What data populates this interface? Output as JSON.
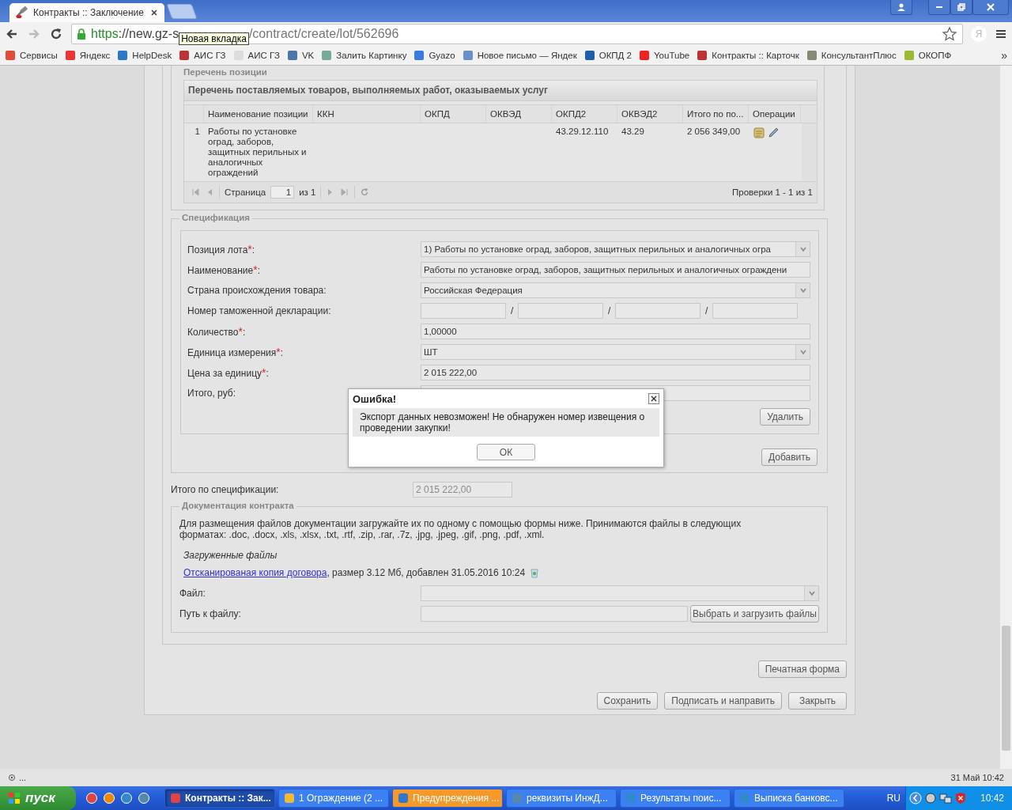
{
  "browser": {
    "tabs": [
      {
        "title": "Контракты :: Заключение",
        "selected": true
      }
    ],
    "url": {
      "scheme": "https",
      "host_part": "://new.gz-s",
      "path_part": "/contract/create/lot/562696"
    },
    "tooltip": "Новая вкладка",
    "profile_letter": "Я",
    "bookmarks": [
      {
        "label": "Сервисы"
      },
      {
        "label": "Яндекс"
      },
      {
        "label": "HelpDesk"
      },
      {
        "label": "АИС ГЗ"
      },
      {
        "label": "АИС ГЗ"
      },
      {
        "label": "VK"
      },
      {
        "label": "Залить Картинку"
      },
      {
        "label": "Gyazo"
      },
      {
        "label": "Новое письмо — Яндек"
      },
      {
        "label": "ОКПД 2"
      },
      {
        "label": "YouTube"
      },
      {
        "label": "Контракты :: Карточк"
      },
      {
        "label": "КонсультантПлюс"
      },
      {
        "label": "ОКОПФ"
      }
    ],
    "bookmarks_more": "»"
  },
  "positions": {
    "legend": "Перечень позиции",
    "grid_title": "Перечень поставляемых товаров, выполняемых работ, оказываемых услуг",
    "columns": [
      "Наименование позиции",
      "ККН",
      "ОКПД",
      "ОКВЭД",
      "ОКПД2",
      "ОКВЭД2",
      "Итого по по...",
      "Операции"
    ],
    "rows": [
      {
        "number": "1",
        "cells": [
          "Работы по установке оград, заборов, защитных перильных и аналогичных ограждений",
          "",
          "",
          "",
          "43.29.12.110",
          "43.29",
          "2 056 349,00"
        ]
      }
    ],
    "pager": {
      "page_label": "Страница",
      "page": "1",
      "of": "из 1",
      "summary": "Проверки 1 - 1 из 1"
    }
  },
  "specification": {
    "legend": "Спецификация",
    "fields": [
      {
        "kind": "select",
        "label": "Позиция лота",
        "required_mark": "*",
        "colon": ":",
        "value": "1) Работы по установке оград, заборов, защитных перильных и аналогичных огра"
      },
      {
        "kind": "text",
        "label": "Наименование",
        "required_mark": "*",
        "colon": ":",
        "value": "Работы по установке оград, заборов, защитных перильных и аналогичных ограждени"
      },
      {
        "kind": "select",
        "label": "Страна происхождения товара:",
        "value": "Российская Федерация"
      },
      {
        "kind": "customs",
        "label": "Номер таможенной декларации:",
        "separators": [
          "/",
          "/",
          "/"
        ]
      },
      {
        "kind": "text",
        "label": "Количество",
        "required_mark": "*",
        "colon": ":",
        "value": "1,00000"
      },
      {
        "kind": "select",
        "label": "Единица измерения",
        "required_mark": "*",
        "colon": ":",
        "value": "ШТ"
      },
      {
        "kind": "text",
        "label": "Цена за единицу",
        "required_mark": "*",
        "colon": ":",
        "value": "2 015 222,00"
      },
      {
        "kind": "text",
        "label": "Итого, руб:"
      }
    ],
    "delete_button": "Удалить",
    "add_button": "Добавить"
  },
  "total": {
    "label": "Итого по спецификации:",
    "value": "2 015 222,00",
    "disabled": true
  },
  "documents": {
    "legend": "Документация контракта",
    "intro": "Для размещения файлов документации загружайте их по одному с помощью формы ниже. Принимаются файлы в следующих форматах: .doc, .docx, .xls, .xlsx, .txt, .rtf, .zip, .rar, .7z, .jpg, .jpeg, .gif, .png, .pdf, .xml.",
    "uploaded_title": "Загруженные файлы",
    "file_link": "Отсканированая копия договора",
    "file_info": ", размер 3.12 Мб, добавлен 31.05.2016 10:24",
    "file_label": "Файл:",
    "path_label": "Путь к файлу:",
    "upload_button": "Выбрать и загрузить файлы"
  },
  "print_button": "Печатная форма",
  "footer_buttons": [
    "Сохранить",
    "Подписать и направить",
    "Закрыть"
  ],
  "dialog": {
    "title": "Ошибка!",
    "message": "Экспорт данных невозможен! Не обнаружен номер извещения о проведении закупки!",
    "ok": "ОК"
  },
  "status": {
    "text": "...",
    "datetime": "31 Май 10:42"
  },
  "taskbar": {
    "start": "пуск",
    "tasks": [
      {
        "label": "Контракты :: Зак...",
        "selected": true,
        "flashing": false
      },
      {
        "label": "1 Ограждение (2 ...",
        "selected": false,
        "flashing": false
      },
      {
        "label": "Предупреждения ...",
        "selected": false,
        "flashing": true
      },
      {
        "label": "реквизиты ИнжД...",
        "selected": false,
        "flashing": false
      },
      {
        "label": "Результаты поис...",
        "selected": false,
        "flashing": false
      },
      {
        "label": "Выписка банковс...",
        "selected": false,
        "flashing": false
      }
    ],
    "language": "RU",
    "time": "10:42"
  }
}
